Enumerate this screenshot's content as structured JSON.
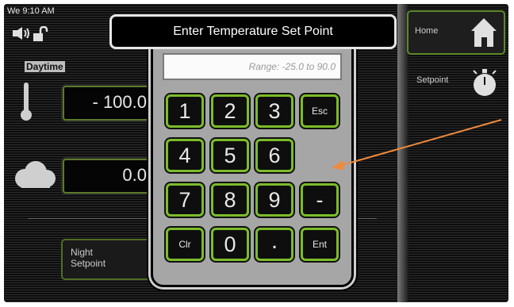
{
  "status": {
    "time": "We 9:10 AM"
  },
  "main": {
    "section_label": "Daytime",
    "day_value": "- 100.0",
    "cloud_value": "0.0",
    "night_button": {
      "line1": "Night",
      "line2": "Setpoint"
    }
  },
  "nav": {
    "home_label": "Home",
    "setpoint_label": "Setpoint"
  },
  "dialog": {
    "title": "Enter Temperature Set Point",
    "range_placeholder": "Range: -25.0 to 90.0",
    "keys": {
      "k1": "1",
      "k2": "2",
      "k3": "3",
      "esc": "Esc",
      "k4": "4",
      "k5": "5",
      "k6": "6",
      "k7": "7",
      "k8": "8",
      "k9": "9",
      "minus": "-",
      "clr": "Clr",
      "k0": "0",
      "dot": ".",
      "ent": "Ent"
    }
  },
  "colors": {
    "key_border": "#7cbc2a",
    "panel": "#a6a6a6",
    "annotation_arrow": "#f08a3c"
  }
}
